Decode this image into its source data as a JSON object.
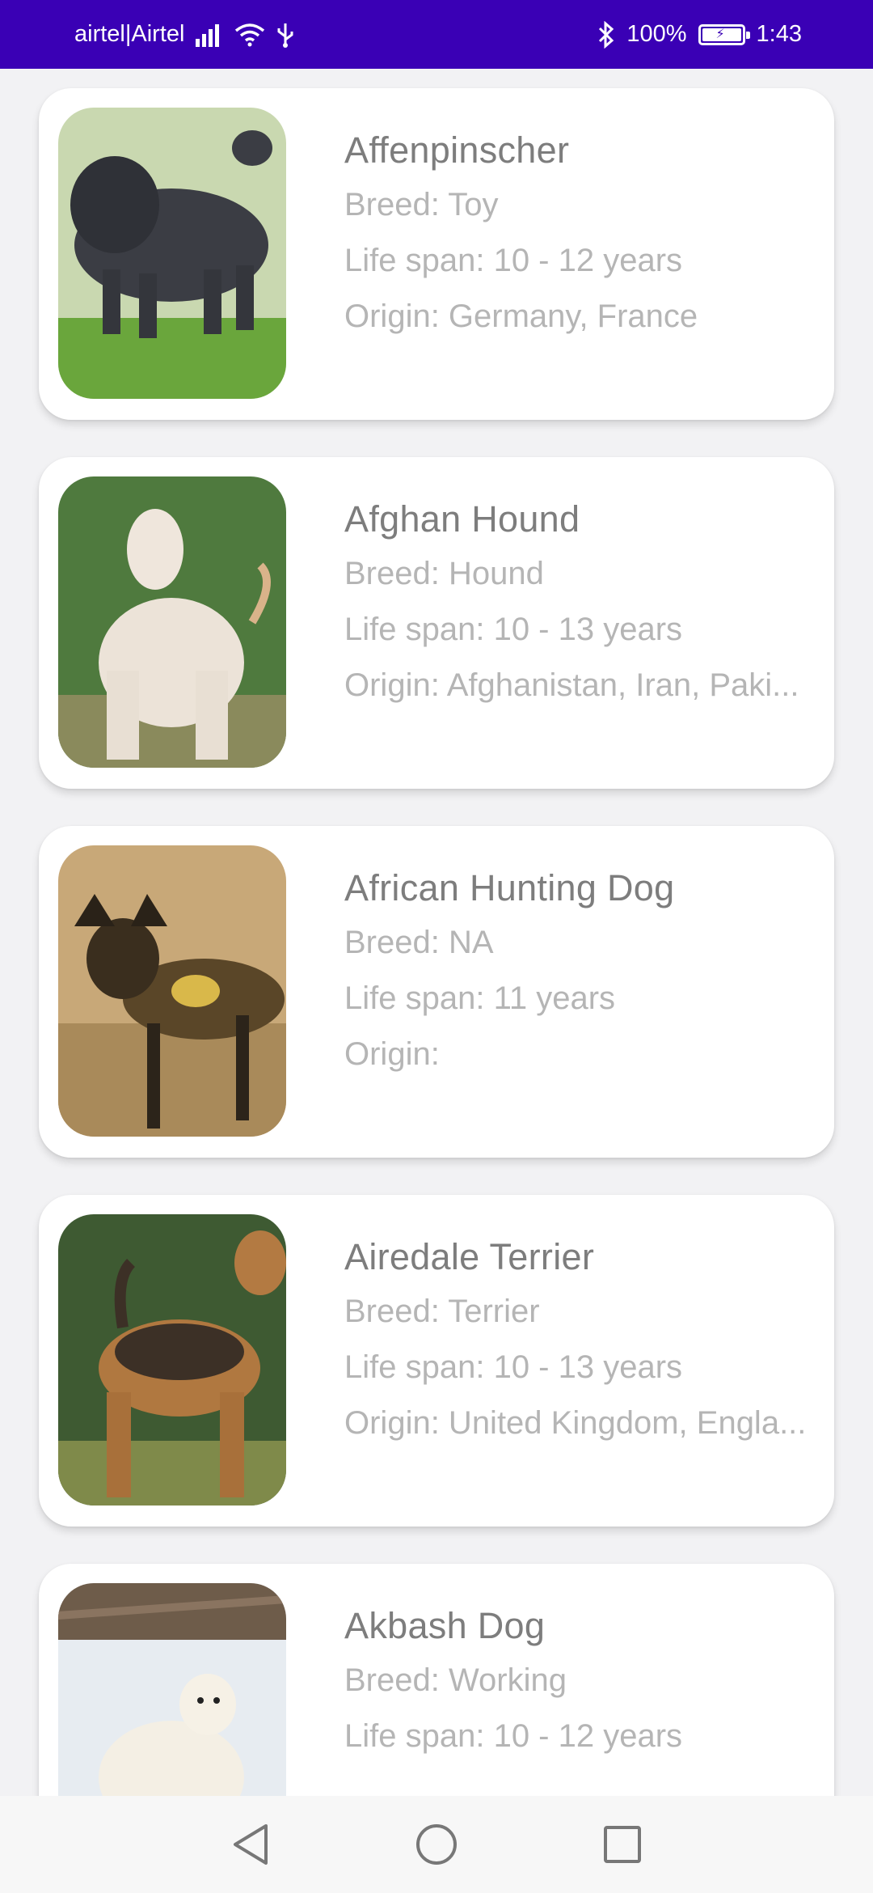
{
  "status_bar": {
    "carrier": "airtel|Airtel",
    "battery_percent": "100%",
    "time": "1:43"
  },
  "dogs": [
    {
      "name": "Affenpinscher",
      "breed": "Breed: Toy",
      "life_span": "Life span: 10 - 12 years",
      "origin": "Origin: Germany, France"
    },
    {
      "name": "Afghan Hound",
      "breed": "Breed: Hound",
      "life_span": "Life span: 10 - 13 years",
      "origin": "Origin: Afghanistan, Iran, Paki..."
    },
    {
      "name": "African Hunting Dog",
      "breed": "Breed: NA",
      "life_span": "Life span: 11 years",
      "origin": "Origin:"
    },
    {
      "name": "Airedale Terrier",
      "breed": "Breed: Terrier",
      "life_span": "Life span: 10 - 13 years",
      "origin": "Origin: United Kingdom, Engla..."
    },
    {
      "name": "Akbash Dog",
      "breed": "Breed: Working",
      "life_span": "Life span: 10 - 12 years",
      "origin": ""
    }
  ],
  "icons": {
    "signal": "signal-icon",
    "wifi": "wifi-icon",
    "usb": "usb-icon",
    "bluetooth": "bluetooth-icon",
    "battery": "battery-icon",
    "back": "back-icon",
    "home": "home-icon",
    "recents": "recents-icon"
  },
  "colors": {
    "status_bar": "#3a00b5",
    "title_text": "#7d7d7d",
    "detail_text": "#b5b5b5",
    "background": "#f2f2f4"
  }
}
